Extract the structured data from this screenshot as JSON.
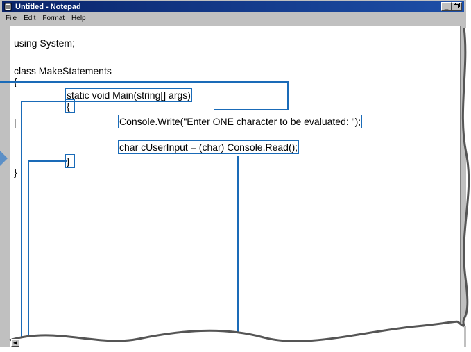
{
  "window": {
    "title": "Untitled - Notepad"
  },
  "window_buttons": {
    "minimize": "_",
    "maximize": "8"
  },
  "menu": [
    "File",
    "Edit",
    "Format",
    "Help"
  ],
  "code": {
    "line1": "using System;",
    "line2": "class MakeStatements",
    "line3": "{",
    "line4": "static void Main(string[] args)",
    "line5": "{",
    "line6": "Console.Write(\"Enter ONE character to be evaluated: \");",
    "line7": "char cUserInput = (char) Console.Read();",
    "line8": "}",
    "line9": "}"
  },
  "colors": {
    "titlebar": "#0a246a",
    "annotation": "#1a6bb8",
    "background": "#c0c0c0"
  },
  "icons": {
    "app": "notepad-icon",
    "scroll_left": "scroll-left-arrow-icon"
  }
}
